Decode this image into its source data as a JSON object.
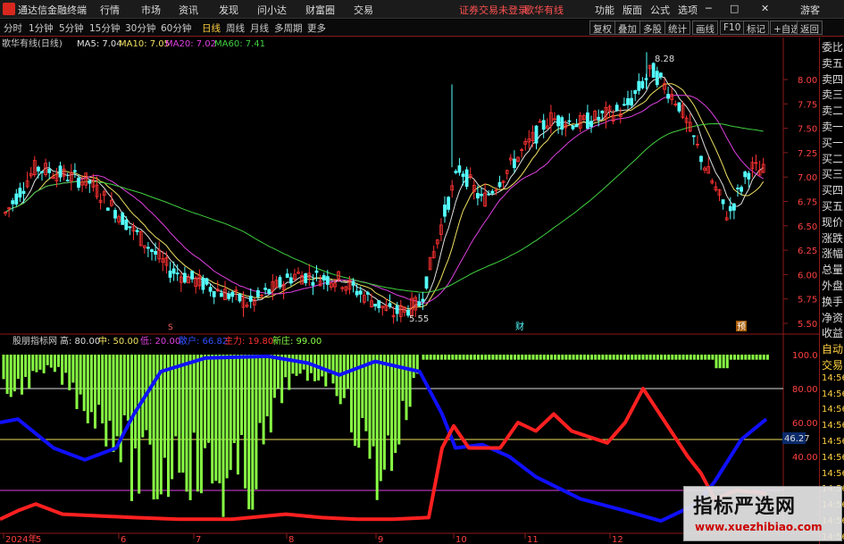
{
  "menubar": {
    "app_title": "通达信金融终端",
    "menus": [
      "行情",
      "市场",
      "资讯",
      "发现",
      "问小达",
      "财富圈",
      "交易"
    ],
    "broker_login": "证券交易未登录",
    "stock": "歌华有线",
    "right_menus": [
      "功能",
      "版面",
      "公式",
      "选项"
    ],
    "guest": "游客"
  },
  "toolbar": {
    "periods": [
      "分时",
      "1分钟",
      "5分钟",
      "15分钟",
      "30分钟",
      "60分钟",
      "日线",
      "周线",
      "月线",
      "多周期",
      "更多"
    ],
    "selected": "日线",
    "buttons": [
      "复权",
      "叠加",
      "多股",
      "统计",
      "画线",
      "F10",
      "标记",
      "+自选",
      "返回"
    ]
  },
  "main": {
    "title": "歌华有线(日线)",
    "ma5": "MA5: 7.04",
    "ma10": "MA10: 7.05",
    "ma20": "MA20: 7.02",
    "ma60": "MA60: 7.41",
    "high_mark": "8.28",
    "low_mark": "5.55",
    "event_markers": [
      "S",
      "财",
      "预"
    ],
    "y_ticks": [
      "8.00",
      "7.75",
      "7.50",
      "7.25",
      "7.00",
      "6.75",
      "6.50",
      "6.25",
      "6.00",
      "5.75",
      "5.50"
    ]
  },
  "indicator": {
    "name": "股朋指标网",
    "high": "高: 80.00",
    "mid": "中: 50.00",
    "low": "低: 20.00",
    "retail": "散户: 66.82",
    "main_force": "主力: 19.80",
    "new_dealer": "新庄: 99.00",
    "y_ticks": [
      "100.0",
      "80.00",
      "60.00",
      "40.00"
    ],
    "current_value": "46.27"
  },
  "x_axis": {
    "labels": [
      "2024年",
      "5",
      "6",
      "7",
      "8",
      "9",
      "10",
      "11",
      "12"
    ]
  },
  "sidebar": {
    "items": [
      "委比",
      "卖五",
      "卖四",
      "卖三",
      "卖二",
      "卖一",
      "买一",
      "买二",
      "买三",
      "买四",
      "买五",
      "现价",
      "涨跌",
      "涨幅",
      "总量",
      "外盘",
      "换手",
      "净资",
      "收益",
      "自动",
      "交易",
      "14:56",
      "14:56",
      "14:56",
      "14:56",
      "14:56",
      "14:56",
      "14:56",
      "14:56",
      "14:56",
      "14:56",
      "14:56"
    ]
  },
  "watermark": {
    "line1": "指标严选网",
    "line2": "www.xuezhibiao.com"
  },
  "colors": {
    "up": "#ff3232",
    "down": "#54ffff",
    "ma5": "#e0e0e0",
    "ma10": "#f0e060",
    "ma20": "#e040e0",
    "ma60": "#40d040",
    "retail": "#1010ff",
    "main_force": "#ff2020",
    "dealer": "#88ff44"
  }
}
